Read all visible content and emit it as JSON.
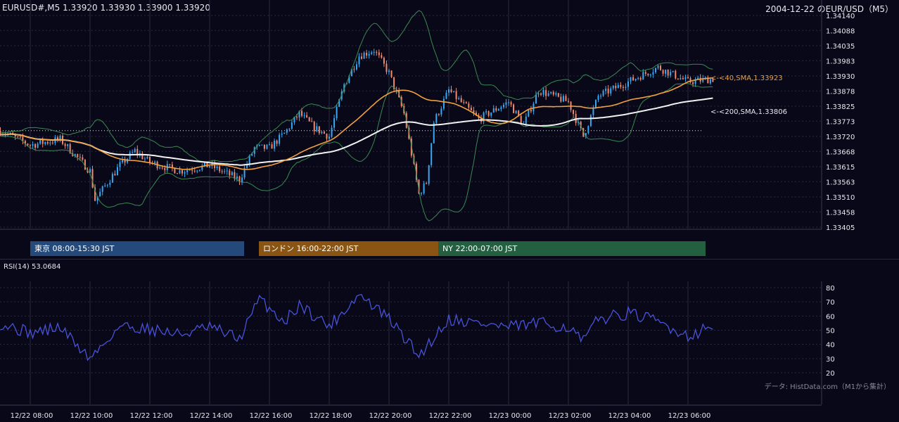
{
  "header": {
    "symbol_info": "EURUSD#,M5 1.33920 1.33930 1.33900 1.33920",
    "title_right": "2004-12-22 のEUR/USD（M5）"
  },
  "sessions": [
    {
      "label": "東京 08:00-15:30 JST",
      "color": "#244a7c"
    },
    {
      "label": "ロンドン 16:00-22:00 JST",
      "color": "#8a5412"
    },
    {
      "label": "NY 22:00-07:00 JST",
      "color": "#236040"
    }
  ],
  "sma_labels": {
    "sma40": "<-<40,SMA,1.33923",
    "sma200": "<-<200,SMA,1.33806"
  },
  "rsi": {
    "label": "RSI(14) 53.0684"
  },
  "footer": {
    "source": "データ: HistData.com（M1から集計）"
  },
  "colors": {
    "background": "#080818",
    "up_candle": "#3aa8f0",
    "down_candle": "#f08a70",
    "sma40": "#f0a040",
    "sma200": "#f2f2f2",
    "bollinger": "#3a8a50",
    "rsi_line": "#4a52d8",
    "grid": "#2a2a3e"
  },
  "chart_data": [
    {
      "type": "candlestick",
      "title": "EURUSD#,M5",
      "y_ticks": [
        "1.34140",
        "1.34088",
        "1.34035",
        "1.33983",
        "1.33930",
        "1.33878",
        "1.33825",
        "1.33773",
        "1.33720",
        "1.33668",
        "1.33615",
        "1.33563",
        "1.33510",
        "1.33458",
        "1.33405"
      ],
      "ylim": [
        1.33405,
        1.3414
      ],
      "x_ticks": [
        "8",
        "10",
        "12",
        "14",
        "16",
        "18",
        "20",
        "22",
        "0",
        "2",
        "4",
        "6"
      ],
      "x_time_labels": [
        "12/22 08:00",
        "12/22 10:00",
        "12/22 12:00",
        "12/22 14:00",
        "12/22 16:00",
        "12/22 18:00",
        "12/22 20:00",
        "12/22 22:00",
        "12/23 00:00",
        "12/23 02:00",
        "12/23 04:00",
        "12/23 06:00"
      ],
      "series": [
        {
          "name": "40,SMA",
          "last": 1.33923
        },
        {
          "name": "200,SMA",
          "last": 1.33806
        }
      ],
      "anchors": [
        {
          "t": "12/22 07:00",
          "close": 1.3374
        },
        {
          "t": "12/22 08:00",
          "close": 1.3369
        },
        {
          "t": "12/22 09:00",
          "close": 1.3371
        },
        {
          "t": "12/22 10:00",
          "close": 1.336
        },
        {
          "t": "12/22 10:10",
          "close": 1.335
        },
        {
          "t": "12/22 11:00",
          "close": 1.3362
        },
        {
          "t": "12/22 11:30",
          "close": 1.3367
        },
        {
          "t": "12/22 12:00",
          "close": 1.3363
        },
        {
          "t": "12/22 13:00",
          "close": 1.336
        },
        {
          "t": "12/22 14:00",
          "close": 1.3362
        },
        {
          "t": "12/22 15:00",
          "close": 1.3357
        },
        {
          "t": "12/22 15:30",
          "close": 1.3368
        },
        {
          "t": "12/22 16:00",
          "close": 1.3368
        },
        {
          "t": "12/22 16:30",
          "close": 1.3373
        },
        {
          "t": "12/22 17:00",
          "close": 1.338
        },
        {
          "t": "12/22 17:30",
          "close": 1.3375
        },
        {
          "t": "12/22 18:00",
          "close": 1.3372
        },
        {
          "t": "12/22 18:30",
          "close": 1.339
        },
        {
          "t": "12/22 19:00",
          "close": 1.34
        },
        {
          "t": "12/22 19:30",
          "close": 1.3402
        },
        {
          "t": "12/22 20:00",
          "close": 1.3394
        },
        {
          "t": "12/22 20:30",
          "close": 1.338
        },
        {
          "t": "12/22 21:00",
          "close": 1.3352
        },
        {
          "t": "12/22 21:15",
          "close": 1.3356
        },
        {
          "t": "12/22 21:30",
          "close": 1.3377
        },
        {
          "t": "12/22 22:00",
          "close": 1.3388
        },
        {
          "t": "12/22 23:00",
          "close": 1.3378
        },
        {
          "t": "12/23 00:00",
          "close": 1.3384
        },
        {
          "t": "12/23 00:30",
          "close": 1.3376
        },
        {
          "t": "12/23 01:00",
          "close": 1.3388
        },
        {
          "t": "12/23 02:00",
          "close": 1.3384
        },
        {
          "t": "12/23 02:30",
          "close": 1.3372
        },
        {
          "t": "12/23 03:00",
          "close": 1.3386
        },
        {
          "t": "12/23 04:00",
          "close": 1.3391
        },
        {
          "t": "12/23 05:00",
          "close": 1.3396
        },
        {
          "t": "12/23 06:00",
          "close": 1.3391
        },
        {
          "t": "12/23 06:50",
          "close": 1.3392
        }
      ],
      "reference_line": 1.3374
    },
    {
      "type": "line",
      "title": "RSI(14) 53.0684",
      "y_ticks": [
        "80",
        "70",
        "60",
        "50",
        "40",
        "30",
        "20"
      ],
      "ylim": [
        20,
        80
      ],
      "last": 53.0684,
      "anchors": [
        {
          "t": "12/22 07:00",
          "value": 55
        },
        {
          "t": "12/22 08:00",
          "value": 48
        },
        {
          "t": "12/22 09:00",
          "value": 52
        },
        {
          "t": "12/22 10:00",
          "value": 30
        },
        {
          "t": "12/22 11:00",
          "value": 53
        },
        {
          "t": "12/22 12:00",
          "value": 51
        },
        {
          "t": "12/22 13:00",
          "value": 47
        },
        {
          "t": "12/22 14:00",
          "value": 52
        },
        {
          "t": "12/22 15:00",
          "value": 44
        },
        {
          "t": "12/22 15:40",
          "value": 72
        },
        {
          "t": "12/22 16:30",
          "value": 56
        },
        {
          "t": "12/22 17:00",
          "value": 68
        },
        {
          "t": "12/22 18:00",
          "value": 53
        },
        {
          "t": "12/22 19:00",
          "value": 75
        },
        {
          "t": "12/22 20:00",
          "value": 58
        },
        {
          "t": "12/22 21:00",
          "value": 32
        },
        {
          "t": "12/22 22:00",
          "value": 58
        },
        {
          "t": "12/23 00:00",
          "value": 52
        },
        {
          "t": "12/23 01:00",
          "value": 55
        },
        {
          "t": "12/23 02:00",
          "value": 52
        },
        {
          "t": "12/23 02:30",
          "value": 42
        },
        {
          "t": "12/23 03:00",
          "value": 58
        },
        {
          "t": "12/23 04:00",
          "value": 62
        },
        {
          "t": "12/23 05:00",
          "value": 56
        },
        {
          "t": "12/23 06:00",
          "value": 46
        },
        {
          "t": "12/23 06:50",
          "value": 53
        }
      ]
    }
  ]
}
